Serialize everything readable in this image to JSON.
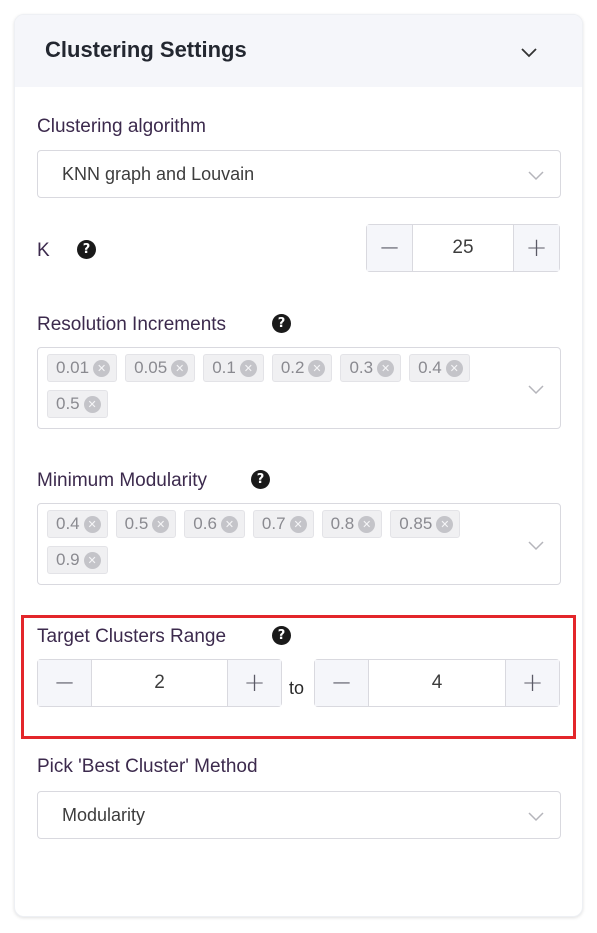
{
  "panel": {
    "title": "Clustering Settings",
    "collapse_icon": "chevron-down-icon"
  },
  "algorithm": {
    "label": "Clustering algorithm",
    "value": "KNN graph and Louvain"
  },
  "k": {
    "label": "K",
    "help": "?",
    "value": "25",
    "minus": "−",
    "plus": "+"
  },
  "resolution": {
    "label": "Resolution Increments",
    "help": "?",
    "tags": [
      "0.01",
      "0.05",
      "0.1",
      "0.2",
      "0.3",
      "0.4",
      "0.5"
    ]
  },
  "modularity": {
    "label": "Minimum Modularity",
    "help": "?",
    "tags": [
      "0.4",
      "0.5",
      "0.6",
      "0.7",
      "0.8",
      "0.85",
      "0.9"
    ]
  },
  "target_range": {
    "label": "Target Clusters Range",
    "help": "?",
    "min_value": "2",
    "max_value": "4",
    "to_label": "to",
    "minus": "−",
    "plus": "+",
    "highlight_color": "#e3262a"
  },
  "best_method": {
    "label": "Pick 'Best Cluster' Method",
    "value": "Modularity"
  },
  "tag_remove_glyph": "✕"
}
